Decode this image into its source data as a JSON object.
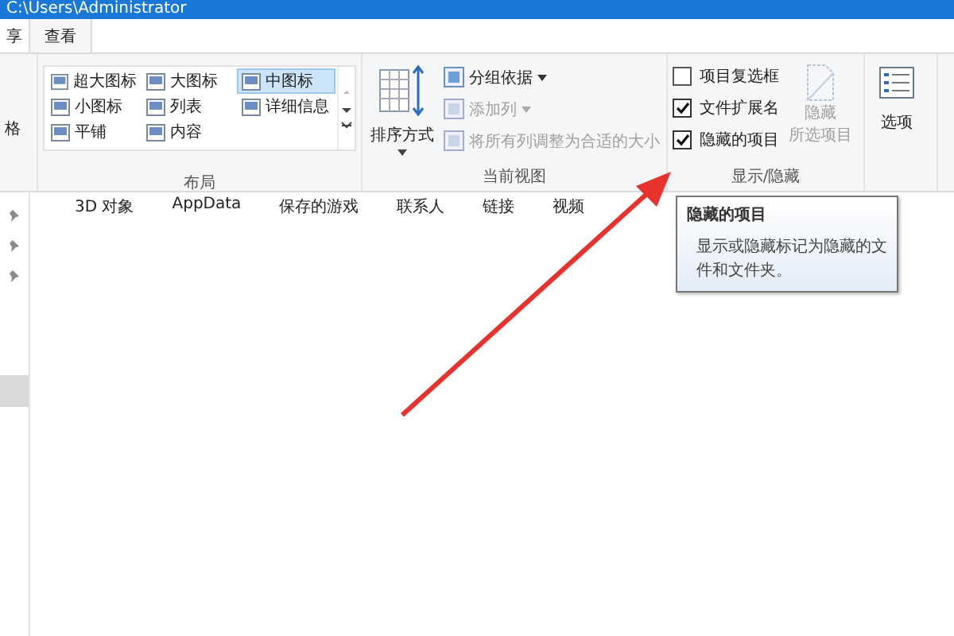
{
  "window": {
    "title": "C:\\Users\\Administrator"
  },
  "tabs": [
    {
      "label": "享",
      "selected": false
    },
    {
      "label": "查看",
      "selected": true
    }
  ],
  "ribbon": {
    "pane_group": {
      "label": "格"
    },
    "layout": {
      "label": "布局",
      "items": [
        {
          "label": "超大图标",
          "selected": false
        },
        {
          "label": "大图标",
          "selected": false
        },
        {
          "label": "中图标",
          "selected": true
        },
        {
          "label": "小图标",
          "selected": false
        },
        {
          "label": "列表",
          "selected": false
        },
        {
          "label": "详细信息",
          "selected": false
        },
        {
          "label": "平铺",
          "selected": false
        },
        {
          "label": "内容",
          "selected": false
        }
      ]
    },
    "current_view": {
      "label": "当前视图",
      "sort": {
        "label": "排序方式"
      },
      "items": [
        {
          "label": "分组依据",
          "disabled": false,
          "dropdown": true
        },
        {
          "label": "添加列",
          "disabled": true,
          "dropdown": true
        },
        {
          "label": "将所有列调整为合适的大小",
          "disabled": true,
          "dropdown": false
        }
      ]
    },
    "show_hide": {
      "label": "显示/隐藏",
      "checkboxes": [
        {
          "label": "项目复选框",
          "checked": false
        },
        {
          "label": "文件扩展名",
          "checked": true
        },
        {
          "label": "隐藏的项目",
          "checked": true
        }
      ],
      "hide_selected": {
        "lines": [
          "隐藏",
          "所选项目"
        ],
        "disabled": true
      }
    },
    "options": {
      "label": "选项"
    }
  },
  "folders": [
    "3D 对象",
    "AppData",
    "保存的游戏",
    "联系人",
    "链接",
    "视频"
  ],
  "tooltip": {
    "title": "隐藏的项目",
    "text": "显示或隐藏标记为隐藏的文件和文件夹。"
  }
}
